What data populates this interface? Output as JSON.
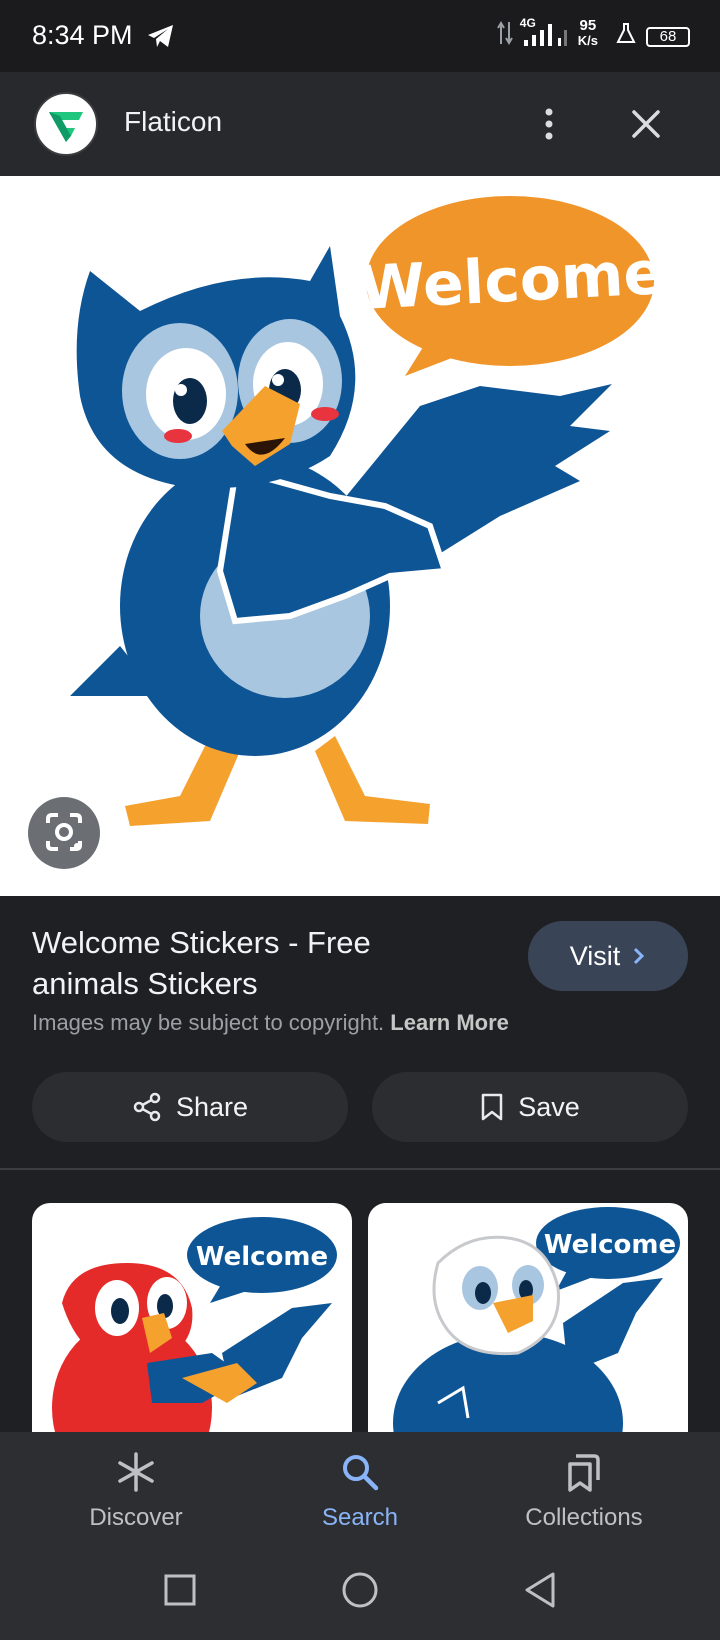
{
  "status_bar": {
    "time": "8:34 PM",
    "network_type": "4G",
    "speed_value": "95",
    "speed_unit": "K/s",
    "battery": "68",
    "icons": [
      "telegram-icon",
      "data-arrows-icon",
      "signal-icon",
      "signal-icon",
      "flask-icon",
      "battery-icon"
    ]
  },
  "header": {
    "site_name": "Flaticon",
    "logo_icon": "flaticon-logo",
    "menu_icon": "more-vert-icon",
    "close_icon": "close-icon"
  },
  "result": {
    "title": "Welcome Stickers - Free animals Stickers",
    "visit_label": "Visit",
    "copyright_text": "Images may be subject to copyright.",
    "learn_more_label": "Learn More",
    "share_label": "Share",
    "save_label": "Save",
    "lens_icon": "lens-icon"
  },
  "main_image": {
    "speech_text": "Welcome",
    "subject": "owl"
  },
  "related": [
    {
      "speech_text": "Welcome",
      "subject": "parrot"
    },
    {
      "speech_text": "Welcome",
      "subject": "eagle"
    }
  ],
  "bottom_nav": {
    "items": [
      {
        "label": "Discover",
        "icon": "asterisk-icon",
        "active": false
      },
      {
        "label": "Search",
        "icon": "search-icon",
        "active": true
      },
      {
        "label": "Collections",
        "icon": "collections-icon",
        "active": false
      }
    ]
  },
  "colors": {
    "accent": "#8ab4f8",
    "bird_blue": "#0e5596",
    "bubble_orange": "#f0952a"
  }
}
